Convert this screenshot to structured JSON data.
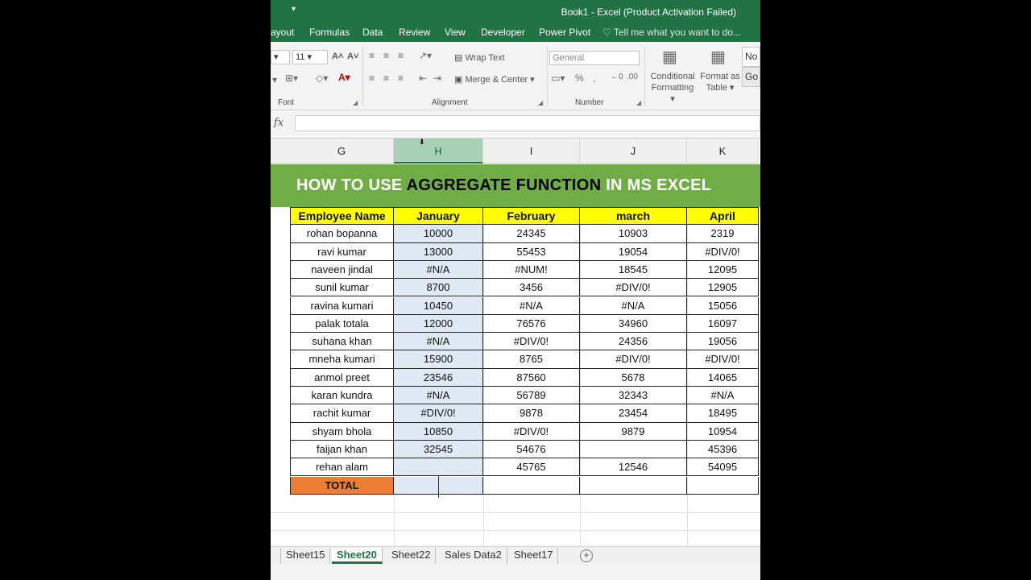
{
  "window": {
    "title": "Book1 - Excel (Product Activation Failed)"
  },
  "ribbon_tabs": [
    "ayout",
    "Formulas",
    "Data",
    "Review",
    "View",
    "Developer",
    "Power Pivot"
  ],
  "tell_me": "Tell me what you want to do...",
  "ribbon": {
    "font_size": "11",
    "font_group": "Font",
    "wrap_text": "Wrap Text",
    "merge_center": "Merge & Center",
    "alignment_group": "Alignment",
    "number_format": "General",
    "number_group": "Number",
    "conditional_formatting": [
      "Conditional",
      "Formatting"
    ],
    "format_as_table": [
      "Format as",
      "Table"
    ],
    "style_normal": "No",
    "style_good": "Go"
  },
  "formula_bar": {
    "fx": "fx",
    "value": ""
  },
  "columns": [
    "G",
    "H",
    "I",
    "J",
    "K"
  ],
  "selected_column": "H",
  "banner": {
    "part1": "HOW TO USE ",
    "part2": "AGGREGATE FUNCTION",
    "part3": " IN MS EXCEL"
  },
  "table": {
    "headers": [
      "Employee Name",
      "January",
      "February",
      "march",
      "April"
    ],
    "rows": [
      [
        "rohan bopanna",
        "10000",
        "24345",
        "10903",
        "2319"
      ],
      [
        "ravi kumar",
        "13000",
        "55453",
        "19054",
        "#DIV/0!"
      ],
      [
        "naveen jindal",
        "#N/A",
        "#NUM!",
        "18545",
        "12095"
      ],
      [
        "sunil kumar",
        "8700",
        "3456",
        "#DIV/0!",
        "12905"
      ],
      [
        "ravina kumari",
        "10450",
        "#N/A",
        "#N/A",
        "15056"
      ],
      [
        "palak totala",
        "12000",
        "76576",
        "34960",
        "16097"
      ],
      [
        "suhana khan",
        "#N/A",
        "#DIV/0!",
        "24356",
        "19056"
      ],
      [
        "mneha kumari",
        "15900",
        "8765",
        "#DIV/0!",
        "#DIV/0!"
      ],
      [
        "anmol preet",
        "23546",
        "87560",
        "5678",
        "14065"
      ],
      [
        "karan kundra",
        "#N/A",
        "56789",
        "32343",
        "#N/A"
      ],
      [
        "rachit kumar",
        "#DIV/0!",
        "9878",
        "23454",
        "18495"
      ],
      [
        "shyam bhola",
        "10850",
        "#DIV/0!",
        "9879",
        "10954"
      ],
      [
        "faijan khan",
        "32545",
        "54676",
        "",
        "45396"
      ],
      [
        "rehan alam",
        "",
        "45765",
        "12546",
        "54095"
      ]
    ],
    "total_label": "TOTAL"
  },
  "sheets": [
    "Sheet15",
    "Sheet20",
    "Sheet22",
    "Sales Data2",
    "Sheet17"
  ],
  "active_sheet": "Sheet20",
  "colors": {
    "excel_green": "#217346",
    "banner": "#70ad47",
    "header_yellow": "#ffff00",
    "total_orange": "#ed7d31"
  }
}
